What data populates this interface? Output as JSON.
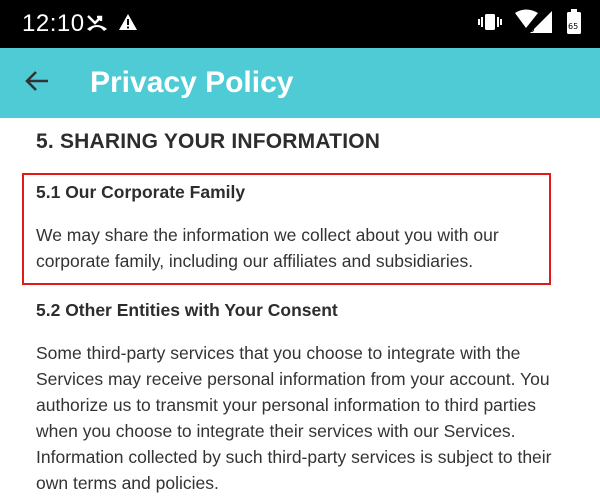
{
  "status_bar": {
    "time": "12:10",
    "left_icons": [
      "missed-call-icon",
      "warning-icon"
    ],
    "right_icons": [
      "vibrate-icon",
      "signal-icon",
      "battery-icon"
    ]
  },
  "app_bar": {
    "back_icon": "arrow-left-icon",
    "title": "Privacy Policy",
    "color": "#4fcbd6"
  },
  "content": {
    "section_title": "5. SHARING YOUR INFORMATION",
    "subsections": [
      {
        "title": "5.1 Our Corporate Family",
        "text": "We may share the information we collect about you with our corporate family, including our affiliates and subsidiaries.",
        "highlighted": true
      },
      {
        "title": "5.2 Other Entities with Your Consent",
        "text": "Some third-party services that you choose to integrate with the Services may receive personal information from your account. You authorize us to transmit your personal information to third parties when you choose to integrate their services with our Services. Information collected by such third-party services is subject to their own terms and policies.",
        "highlighted": false
      }
    ],
    "highlight_color": "#e31919"
  }
}
